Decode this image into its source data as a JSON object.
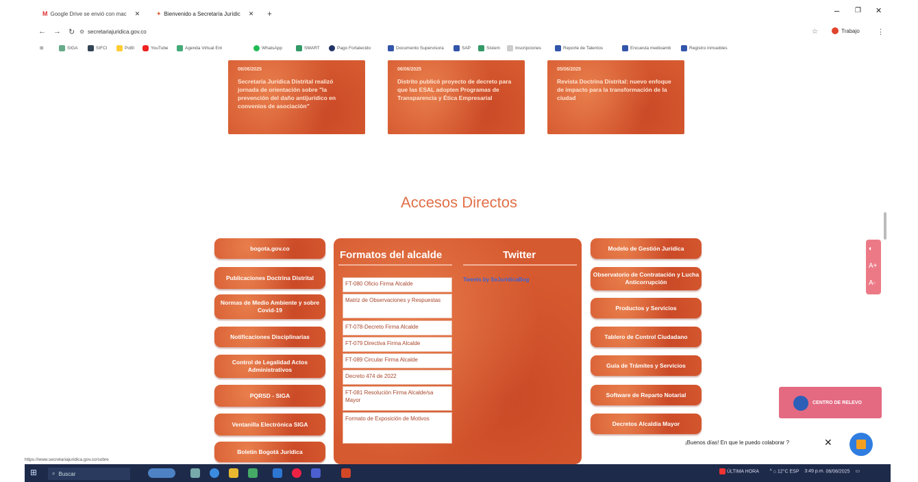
{
  "browser": {
    "tabs": [
      {
        "label": "Google Drive se envió con mac"
      },
      {
        "label": "Bienvenido a Secretaría Jurídic"
      }
    ],
    "new_tab": "+",
    "url": "secretariajuridica.gov.co",
    "profile_label": "Trabajo",
    "bookmarks": [
      "SIGA",
      "SIFCI",
      "PoBI",
      "YouTube",
      "Agenda Virtual Ent",
      "WhatsApp",
      "SMART",
      "Pago Fortalecido",
      "Documento Supervisora",
      "SAP",
      "Sistem",
      "Inscripciones",
      "Reporte de Talentos",
      "Encuesta medioamb",
      "Registro inmuebles"
    ]
  },
  "news": [
    {
      "date": "06/06/2025",
      "text": "Secretaría Jurídica Distrital realizó jornada de orientación sobre \"la prevención del daño antijurídico en convenios de asociación\""
    },
    {
      "date": "06/06/2025",
      "text": "Distrito publicó proyecto de decreto para que las ESAL adopten Programas de Transparencia y Ética Empresarial"
    },
    {
      "date": "05/06/2025",
      "text": "Revista Doctrina Distrital: nuevo enfoque de impacto para la transformación de la ciudad"
    }
  ],
  "section_title": "Accesos Directos",
  "left_links": [
    "bogota.gov.co",
    "Publicaciones Doctrina Distrital",
    "Normas de Medio Ambiente y sobre Covid-19",
    "Notificaciones Disciplinarias",
    "Control de Legalidad Actos Administrativos",
    "PQRSD - SIGA",
    "Ventanilla Electrónica SIGA",
    "Boletín Bogotá Jurídica"
  ],
  "right_links": [
    "Modelo de Gestión Jurídica",
    "Observatorio de Contratación y Lucha Anticorrupción",
    "Productos y Servicios",
    "Tablero de Control Ciudadano",
    "Guía de Trámites y Servicios",
    "Software de Reparto Notarial",
    "Decretos Alcaldía Mayor"
  ],
  "formatos": {
    "title": "Formatos del alcalde",
    "items": [
      "FT-080 Oficio Firma Alcalde",
      "Matriz de Observaciones y Respuestas",
      "FT-078-Decreto Firma Alcalde",
      "FT-079 Directiva Firma Alcalde",
      "FT-089 Circular Firma Alcalde",
      "Decreto 474 de 2022",
      "FT-081 Resolución Firma Alcalde/sa Mayor",
      "Formato de Exposición de Motivos"
    ]
  },
  "twitter": {
    "title": "Twitter",
    "link": "Tweets by SeJuridicaBog"
  },
  "centro_relevo": "CENTRO DE RELEVO",
  "chat": {
    "greeting": "¡Buenos días! En que le puedo colaborar ?"
  },
  "status_url": "https://www.secretariajuridica.gov.co/sobre",
  "taskbar": {
    "search": "Buscar",
    "news": "ÚLTIMA HORA",
    "weather": "12°C",
    "lang": "ESP",
    "time": "3:49 p.m.",
    "date": "06/06/2025"
  },
  "colors": {
    "accent": "#d65a30",
    "title": "#e07048",
    "chat": "#2f7de0"
  }
}
